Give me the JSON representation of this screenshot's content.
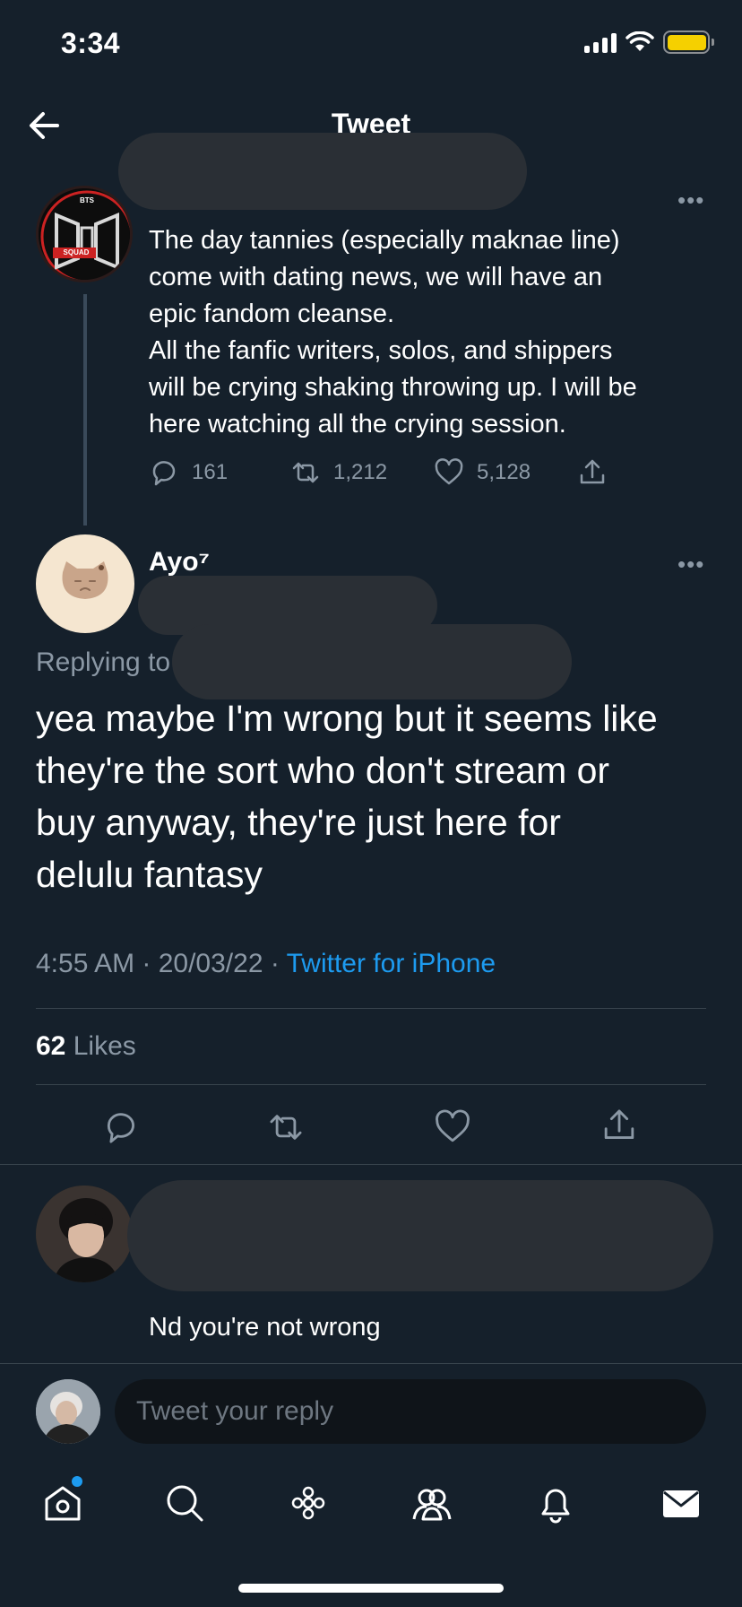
{
  "status": {
    "time": "3:34"
  },
  "nav": {
    "title": "Tweet"
  },
  "parent_tweet": {
    "text_lines": [
      "The day tannies (especially maknae line)",
      "come with dating news, we will have an",
      "epic fandom cleanse.",
      "All the fanfic writers, solos, and shippers",
      "will be crying shaking throwing up. I will be",
      "here watching all the crying session."
    ],
    "replies": "161",
    "retweets": "1,212",
    "likes": "5,128",
    "avatar_text": {
      "top": "BTS",
      "band": "SQUAD"
    }
  },
  "main_tweet": {
    "author": "Ayo⁷",
    "replying_prefix": "Replying to",
    "text_lines": [
      "yea maybe I'm wrong but it seems like",
      "they're the sort who don't stream or",
      "buy anyway, they're just here for",
      "delulu fantasy"
    ],
    "timestamp": "4:55 AM · 20/03/22 · ",
    "source": "Twitter for iPhone",
    "likes_count": "62",
    "likes_label": "Likes"
  },
  "reply_tweet": {
    "text": "Nd you're not wrong"
  },
  "composer": {
    "placeholder": "Tweet your reply"
  },
  "colors": {
    "background": "#15202b",
    "accent": "#1d9bf0",
    "secondary_text": "#8b98a5",
    "divider": "#38444d",
    "battery": "#f5d000"
  },
  "icons": {
    "tabs": [
      "home-icon",
      "search-icon",
      "spaces-icon",
      "communities-icon",
      "notifications-icon",
      "messages-icon"
    ],
    "actions": [
      "reply-icon",
      "retweet-icon",
      "like-icon",
      "share-icon"
    ]
  }
}
